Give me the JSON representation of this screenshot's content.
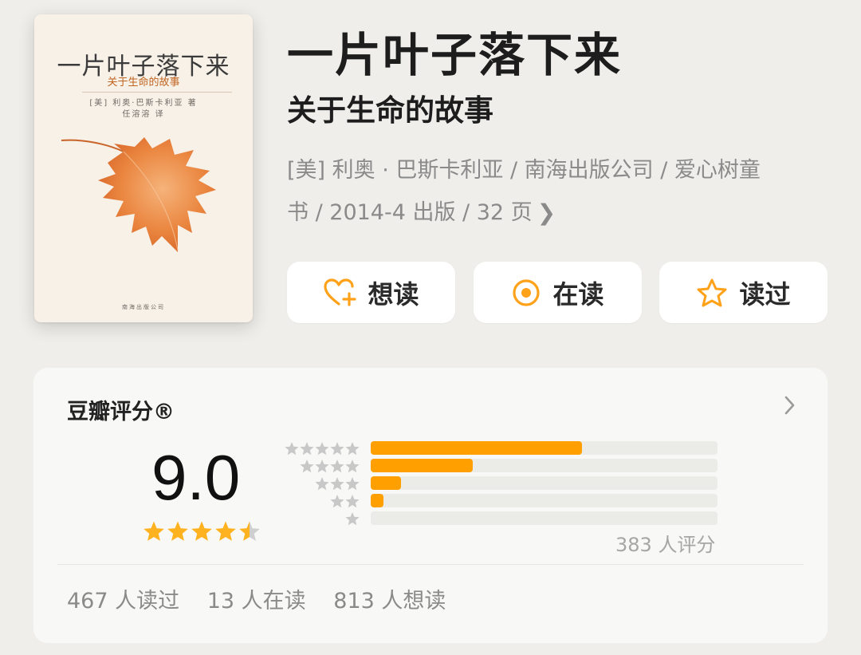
{
  "cover": {
    "title": "一片叶子落下来",
    "subtitle": "关于生命的故事",
    "author_line": "[美] 利奥·巴斯卡利亚 著",
    "translator_line": "任溶溶 译",
    "publisher": "南海出版公司"
  },
  "book": {
    "title": "一片叶子落下来",
    "subtitle": "关于生命的故事",
    "meta_line1": "[美] 利奥 · 巴斯卡利亚 / 南海出版公司 / 爱心树童",
    "meta_line2": "书 / 2014-4 出版 / 32 页"
  },
  "actions": {
    "want": {
      "label": "想读",
      "icon": "heart-plus-icon"
    },
    "reading": {
      "label": "在读",
      "icon": "target-circle-icon"
    },
    "read": {
      "label": "读过",
      "icon": "star-outline-icon"
    }
  },
  "rating": {
    "title": "豆瓣评分®",
    "score": "9.0",
    "stars_filled": 4.5,
    "count_text": "383 人评分",
    "distribution": [
      {
        "stars": 5,
        "fraction": 0.61
      },
      {
        "stars": 4,
        "fraction": 0.295
      },
      {
        "stars": 3,
        "fraction": 0.087
      },
      {
        "stars": 2,
        "fraction": 0.037
      },
      {
        "stars": 1,
        "fraction": 0.0
      }
    ],
    "stats": {
      "read": "467 人读过",
      "reading": "13 人在读",
      "want": "813 人想读"
    }
  },
  "colors": {
    "accent_orange": "#ff9f00",
    "star_gold": "#ffb21f",
    "background": "#efeeea"
  }
}
